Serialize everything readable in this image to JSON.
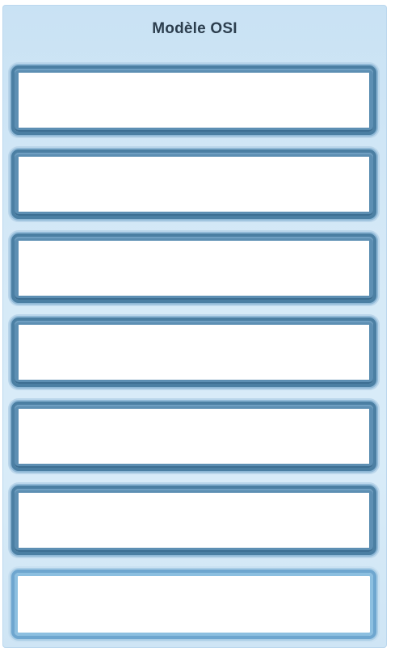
{
  "diagram": {
    "title": "Modèle OSI",
    "layer_slots": [
      {
        "label": ""
      },
      {
        "label": ""
      },
      {
        "label": ""
      },
      {
        "label": ""
      },
      {
        "label": ""
      },
      {
        "label": ""
      },
      {
        "label": ""
      }
    ]
  },
  "colors": {
    "panel_background": "#d5e9f7",
    "slot_border": "#4b7fa3",
    "slot_border_highlight": "#6ea6cf",
    "title_text": "#2c3e4e"
  }
}
